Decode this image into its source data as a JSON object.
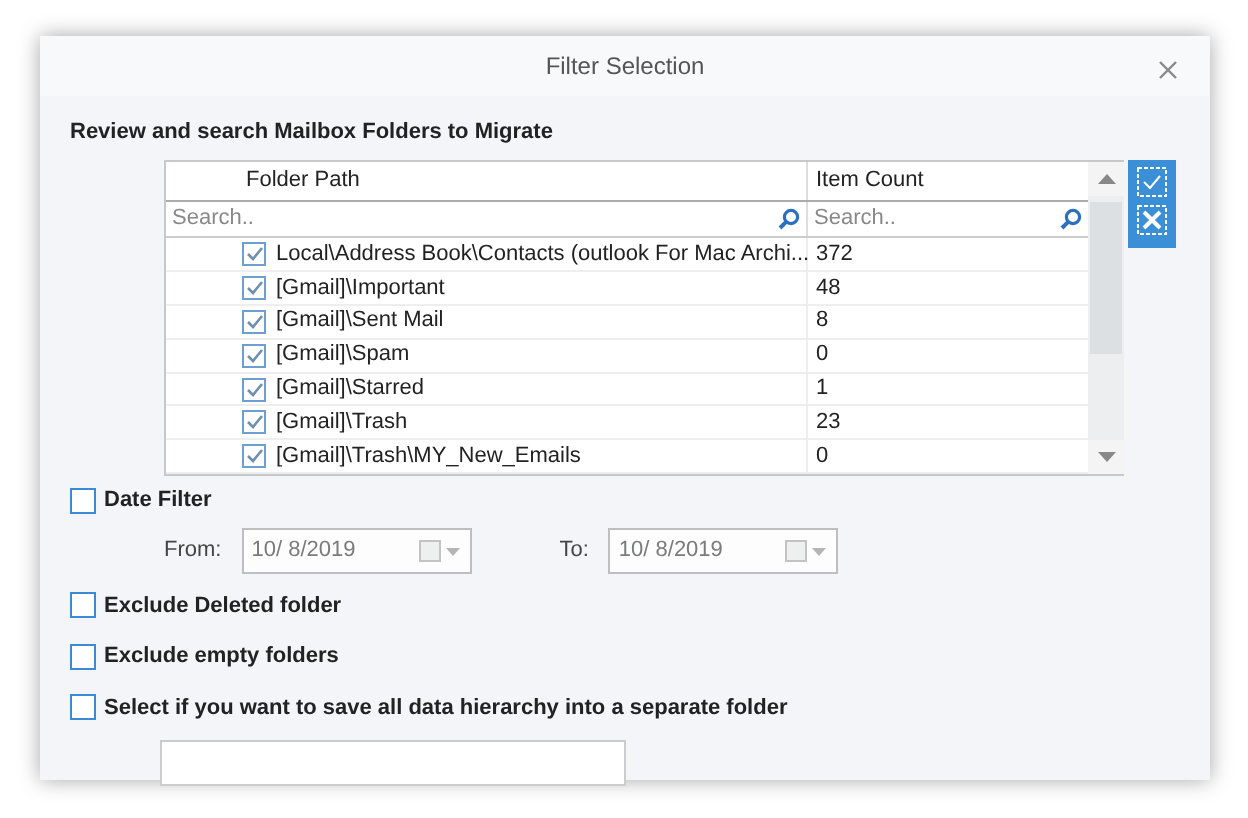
{
  "window": {
    "title": "Filter Selection"
  },
  "heading": "Review and search Mailbox Folders to Migrate",
  "table": {
    "columns": [
      "Folder Path",
      "Item Count"
    ],
    "search_placeholders": [
      "Search..",
      "Search.."
    ],
    "rows": [
      {
        "path": "Local\\Address Book\\Contacts (outlook For Mac Archi...",
        "count": "372",
        "checked": true
      },
      {
        "path": "[Gmail]\\Important",
        "count": "48",
        "checked": true
      },
      {
        "path": "[Gmail]\\Sent Mail",
        "count": "8",
        "checked": true
      },
      {
        "path": "[Gmail]\\Spam",
        "count": "0",
        "checked": true
      },
      {
        "path": "[Gmail]\\Starred",
        "count": "1",
        "checked": true
      },
      {
        "path": "[Gmail]\\Trash",
        "count": "23",
        "checked": true
      },
      {
        "path": "[Gmail]\\Trash\\MY_New_Emails",
        "count": "0",
        "checked": true
      }
    ]
  },
  "date_filter": {
    "label": "Date Filter",
    "checked": false,
    "from_label": "From:",
    "from_value": "10/  8/2019",
    "to_label": "To:",
    "to_value": "10/  8/2019"
  },
  "options": [
    {
      "label": "Exclude Deleted folder",
      "checked": false
    },
    {
      "label": "Exclude empty folders",
      "checked": false
    },
    {
      "label": "Select if you want to save all data hierarchy into a separate folder",
      "checked": false
    }
  ]
}
